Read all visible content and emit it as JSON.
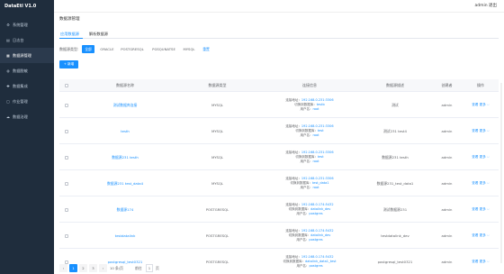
{
  "app": {
    "brand": "DataEtl V1.0",
    "user": "admin 退出"
  },
  "sidebar": {
    "items": [
      {
        "label": "系统管理",
        "icon": "⚙",
        "icon_name": "settings-icon"
      },
      {
        "label": "日志台",
        "icon": "▤",
        "icon_name": "log-icon"
      },
      {
        "label": "数据源管理",
        "icon": "▦",
        "icon_name": "datasource-icon",
        "active": true
      },
      {
        "label": "数据脱敏",
        "icon": "◍",
        "icon_name": "mask-icon"
      },
      {
        "label": "数据集成",
        "icon": "✚",
        "icon_name": "integration-icon"
      },
      {
        "label": "作业管理",
        "icon": "▢",
        "icon_name": "job-icon"
      },
      {
        "label": "数据治理",
        "icon": "☁",
        "icon_name": "governance-icon"
      }
    ]
  },
  "page": {
    "title": "数据源管理",
    "tabs": [
      {
        "label": "应用数据源",
        "active": true
      },
      {
        "label": "解析数据源",
        "active": false
      }
    ],
    "filter": {
      "label": "数据源类型:",
      "options": [
        "全部",
        "ORACLE",
        "POSTGRESQL",
        "PGSQUNATSE",
        "MYSQL"
      ],
      "active_index": 0,
      "action": "重置"
    },
    "add_button": "+ 新增"
  },
  "table": {
    "headers": [
      "数据源名称",
      "数据源类型",
      "连接信息",
      "数据源描述",
      "创建者",
      "操作"
    ],
    "conn_keys": {
      "addr": "连接地址：",
      "db": "切换到数据库：",
      "user": "用户名："
    },
    "ops_label": "查看 更多 ⌵",
    "rows": [
      {
        "name": "测试数据库连接",
        "type": "MYSQL",
        "addr": "192.168.0.231:3306",
        "db": "testb",
        "user": "root",
        "desc": "测试",
        "creator": "admin"
      },
      {
        "name": "testh",
        "type": "MYSQL",
        "addr": "192.168.0.231:3306",
        "db": "test",
        "user": "root",
        "desc": "测试231 test4",
        "creator": "admin"
      },
      {
        "name": "数据源231 testh",
        "type": "MYSQL",
        "addr": "192.168.0.231:3306",
        "db": "test",
        "user": "root",
        "desc": "数据源231 testh",
        "creator": "admin"
      },
      {
        "name": "数据源231 test_data4",
        "type": "MYSQL",
        "addr": "192.168.0.231:3306",
        "db": "test_data1",
        "user": "root",
        "desc": "数据源231_test_data1",
        "creator": "admin"
      },
      {
        "name": "数据源174",
        "type": "POSTGRESQL",
        "addr": "192.168.0.174:5432",
        "db": "datalink_dev",
        "user": "postgres",
        "desc": "测试数据源231",
        "creator": "admin"
      },
      {
        "name": "testdatalink",
        "type": "POSTGRESQL",
        "addr": "192.168.0.174:5432",
        "db": "datalink_dev",
        "user": "postgres",
        "desc": "testdatalink_dev",
        "creator": "admin"
      },
      {
        "name": "postgresql_test0321",
        "type": "POSTGRESQL",
        "addr": "192.168.0.174:5432",
        "db": "datalink_data1_test",
        "user": "postgres",
        "desc": "postgresql_test0321",
        "creator": "admin"
      }
    ]
  },
  "pager": {
    "prev": "‹",
    "pages": [
      "1",
      "2",
      "3"
    ],
    "current": "1",
    "next": "›",
    "size": "10 条/页",
    "goto_label": "前往",
    "goto_value": "1",
    "goto_unit": "页"
  },
  "colors": {
    "accent": "#1890ff",
    "sidebar": "#1f2d3d"
  }
}
